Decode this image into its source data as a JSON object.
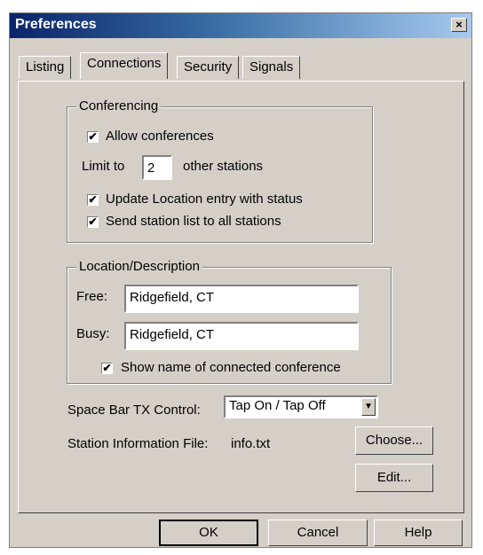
{
  "window": {
    "title": "Preferences",
    "close_label": "×"
  },
  "tabs": [
    {
      "label": "Listing"
    },
    {
      "label": "Connections"
    },
    {
      "label": "Security"
    },
    {
      "label": "Signals"
    }
  ],
  "conferencing": {
    "legend": "Conferencing",
    "allow_label": "Allow conferences",
    "allow_checked": true,
    "limit_prefix": "Limit to",
    "limit_value": "2",
    "limit_suffix": "other stations",
    "update_label": "Update Location entry with status",
    "update_checked": true,
    "send_label": "Send station list to all stations",
    "send_checked": true
  },
  "location": {
    "legend": "Location/Description",
    "free_label": "Free:",
    "free_value": "Ridgefield, CT",
    "busy_label": "Busy:",
    "busy_value": "Ridgefield, CT",
    "show_label": "Show name of connected conference",
    "show_checked": true
  },
  "spacebar": {
    "label": "Space Bar TX Control:",
    "value": "Tap On / Tap Off"
  },
  "station_file": {
    "label": "Station Information File:",
    "value": "info.txt",
    "choose_label": "Choose...",
    "edit_label": "Edit..."
  },
  "buttons": {
    "ok": "OK",
    "cancel": "Cancel",
    "help": "Help"
  },
  "icons": {
    "checkmark": "✔",
    "dropdown": "▼"
  }
}
